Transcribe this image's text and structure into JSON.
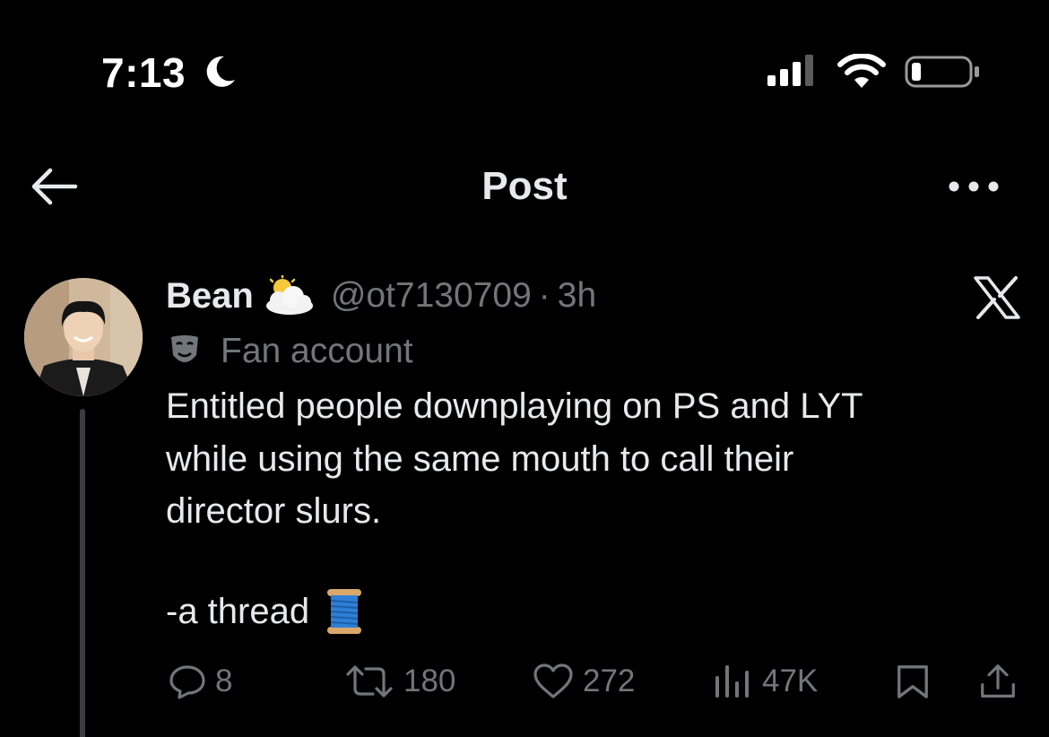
{
  "status_bar": {
    "time": "7:13",
    "icons": [
      "moon-icon",
      "cellular-signal-icon",
      "wifi-icon",
      "battery-icon"
    ]
  },
  "nav": {
    "title": "Post",
    "back_icon": "arrow-left-icon",
    "more_icon": "more-horizontal-icon"
  },
  "post": {
    "author": {
      "display_name": "Bean",
      "name_emoji": "sun-behind-cloud-emoji",
      "handle": "@ot7130709",
      "separator": "·",
      "age": "3h",
      "label_icon": "performing-arts-mask-icon",
      "label": "Fan account"
    },
    "text_lines": [
      "Entitled people downplaying on PS and LYT",
      "while using the same mouth to call their",
      "director slurs."
    ],
    "thread_line": "-a thread",
    "thread_emoji": "spool-of-thread-emoji",
    "actions": {
      "replies": "8",
      "reposts": "180",
      "likes": "272",
      "views": "47K"
    }
  },
  "colors": {
    "background": "#000000",
    "text_primary": "#e7e9ea",
    "text_secondary": "#71767b",
    "thread_line": "#3a3d40"
  }
}
